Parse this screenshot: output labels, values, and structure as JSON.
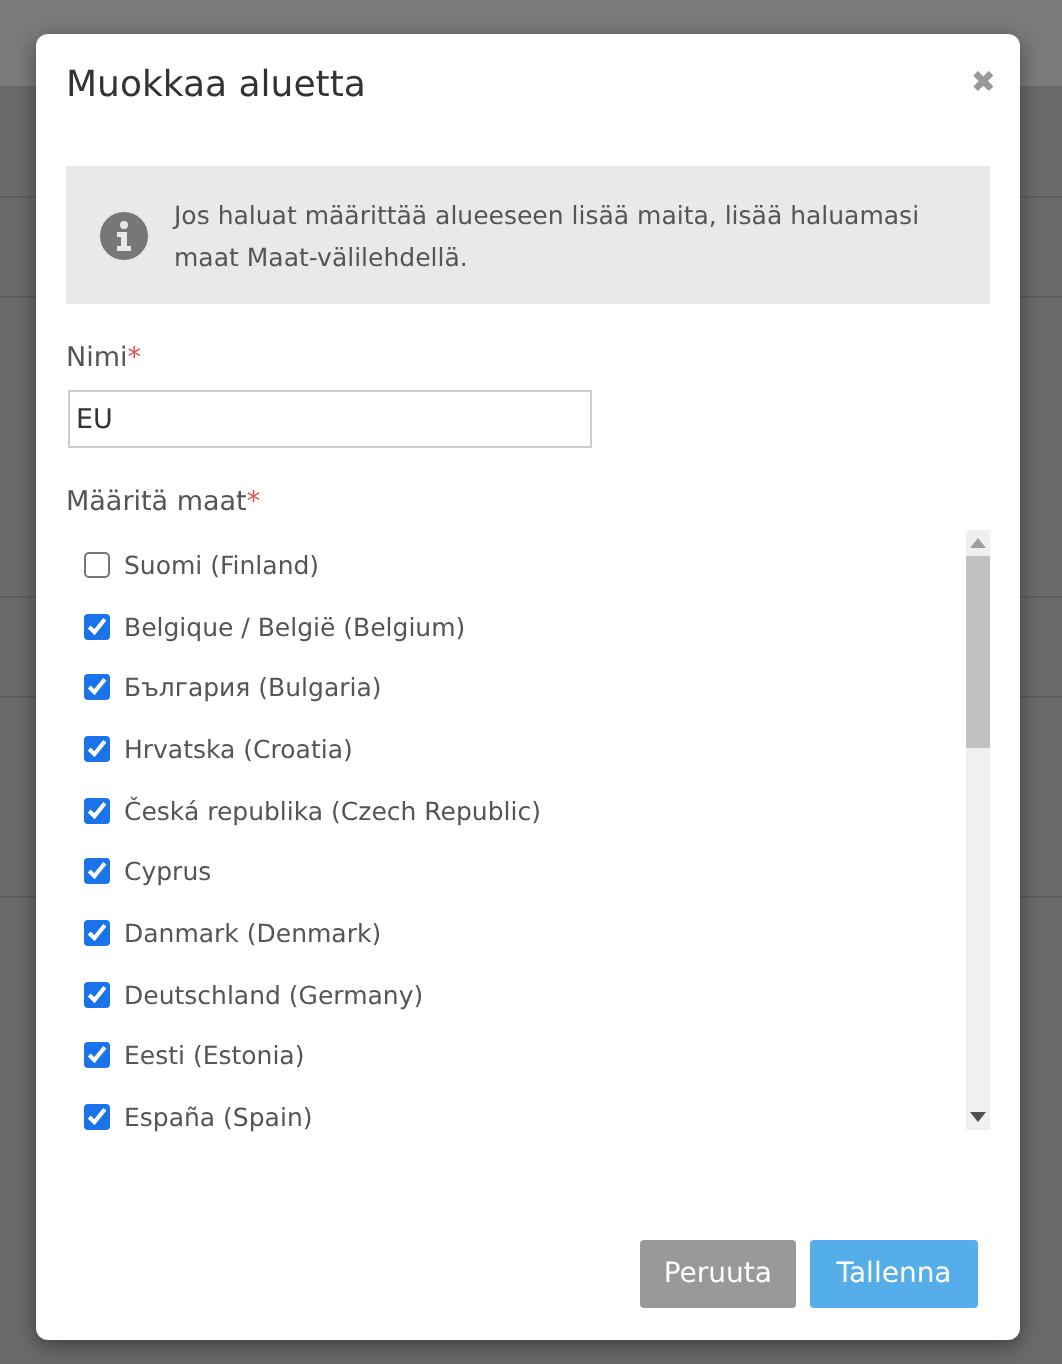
{
  "dialog": {
    "title": "Muokkaa aluetta",
    "close": "✖"
  },
  "info": {
    "text": "Jos haluat määrittää alueeseen lisää maita, lisää haluamasi maat Maat-välilehdellä."
  },
  "name_field": {
    "label": "Nimi",
    "required_mark": "*",
    "value": "EU"
  },
  "countries": {
    "label": "Määritä maat",
    "required_mark": "*",
    "items": [
      {
        "label": "Suomi (Finland)",
        "checked": false
      },
      {
        "label": "Belgique / België (Belgium)",
        "checked": true
      },
      {
        "label": "България (Bulgaria)",
        "checked": true
      },
      {
        "label": "Hrvatska (Croatia)",
        "checked": true
      },
      {
        "label": "Česká republika (Czech Republic)",
        "checked": true
      },
      {
        "label": "Cyprus",
        "checked": true
      },
      {
        "label": "Danmark (Denmark)",
        "checked": true
      },
      {
        "label": "Deutschland (Germany)",
        "checked": true
      },
      {
        "label": "Eesti (Estonia)",
        "checked": true
      },
      {
        "label": "España (Spain)",
        "checked": true
      }
    ]
  },
  "buttons": [
    {
      "label": "Peruuta",
      "kind": "secondary"
    },
    {
      "label": "Tallenna",
      "kind": "primary"
    }
  ]
}
